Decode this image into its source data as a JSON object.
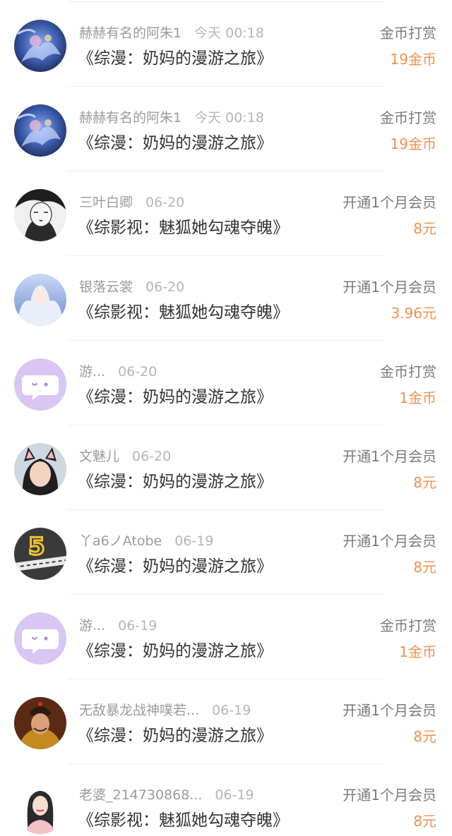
{
  "colors": {
    "amount": "#f0924f",
    "name": "#9b9b9b",
    "title": "#333333",
    "type": "#7a7a7a",
    "chat_avatar_bg": "#d9c6f2"
  },
  "items": [
    {
      "avatar": "fantasy-art-avatar",
      "name": "赫赫有名的阿朱1",
      "date": "今天 00:18",
      "title": "《综漫：奶妈的漫游之旅》",
      "type": "金币打赏",
      "amount": "19金币"
    },
    {
      "avatar": "fantasy-art-avatar",
      "name": "赫赫有名的阿朱1",
      "date": "今天 00:18",
      "title": "《综漫：奶妈的漫游之旅》",
      "type": "金币打赏",
      "amount": "19金币"
    },
    {
      "avatar": "sketch-portrait-avatar",
      "name": "三叶白卿",
      "date": "06-20",
      "title": "《综影视：魅狐她勾魂夺魄》",
      "type": "开通1个月会员",
      "amount": "8元"
    },
    {
      "avatar": "angel-girl-avatar",
      "name": "银落云裳",
      "date": "06-20",
      "title": "《综影视：魅狐她勾魂夺魄》",
      "type": "开通1个月会员",
      "amount": "3.96元"
    },
    {
      "avatar": "chat-bubble-avatar",
      "name": "游...",
      "date": "06-20",
      "title": "《综漫：奶妈的漫游之旅》",
      "type": "金币打赏",
      "amount": "1金币"
    },
    {
      "avatar": "cat-ears-photo-avatar",
      "name": "文魅儿",
      "date": "06-20",
      "title": "《综漫：奶妈的漫游之旅》",
      "type": "开通1个月会员",
      "amount": "8元"
    },
    {
      "avatar": "number-five-road-avatar",
      "name": "丫a6ノAtobe",
      "date": "06-19",
      "title": "《综漫：奶妈的漫游之旅》",
      "type": "开通1个月会员",
      "amount": "8元"
    },
    {
      "avatar": "chat-bubble-avatar",
      "name": "游...",
      "date": "06-19",
      "title": "《综漫：奶妈的漫游之旅》",
      "type": "金币打赏",
      "amount": "1金币"
    },
    {
      "avatar": "emperor-costume-avatar",
      "name": "无敌暴龙战神噗若...",
      "date": "06-19",
      "title": "《综漫：奶妈的漫游之旅》",
      "type": "开通1个月会员",
      "amount": "8元"
    },
    {
      "avatar": "illustrated-woman-avatar",
      "name": "老婆_214730868...",
      "date": "06-19",
      "title": "《综影视：魅狐她勾魂夺魄》",
      "type": "开通1个月会员",
      "amount": "8元"
    }
  ]
}
